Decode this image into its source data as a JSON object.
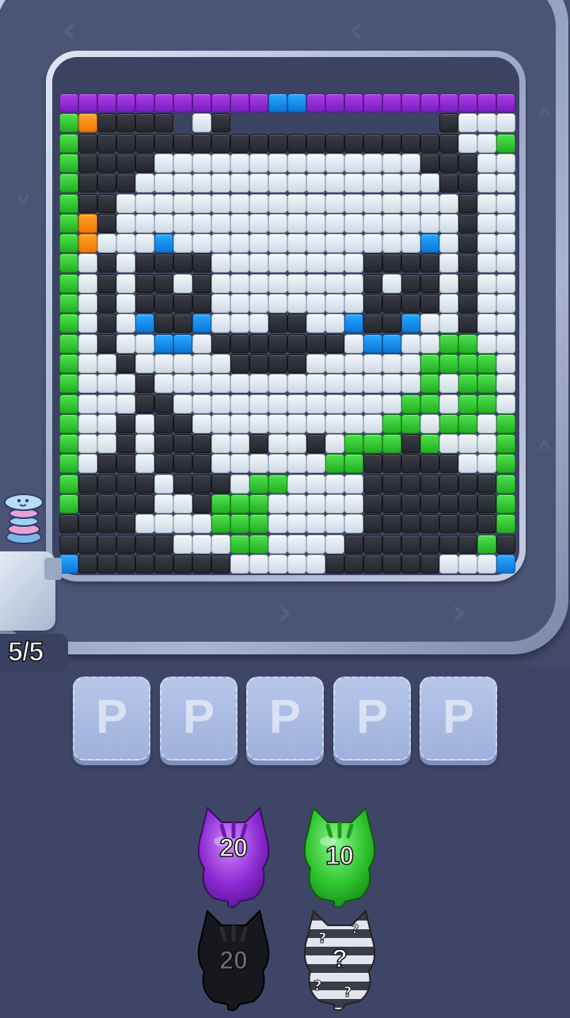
{
  "board": {
    "palette": {
      "k": "#2b2d35",
      "w": "#e3eaf1",
      "g": "#2fc52f",
      "p": "#8e2bd4",
      "b": "#1592ee",
      "o": "#ff8c0f"
    },
    "rows": [
      "pppppppppppbbppppppppppp",
      "gokkkk.wk...........kwwwg",
      "gkkkkkkkkkkkkkkkkkkkkwwg",
      "gkkkkwwwwwwwwwwwwwwkkkwwg",
      "gkkkwwwwwwwwwwwwwwwwkkwwg",
      "gkkwwwwwwwwwwwwwwwwwwkwwg",
      "gokwwwwwwwwwwwwwwwwwwkwwg",
      "gowwwbwwwwwwwwwwwwwbwkwwg",
      "gwkwkkkkwwwwwwwwkkkkwkwwg",
      "gwkwkkwkwwwwwwwwkwkkwkwwg",
      "gwkwkkkkwwwwwwwwkkkkwkwwg",
      "gwkwbkkbwwwkkwwbkkbwwkwwg",
      "gwkwwbbwkkkkkkkwbbwwggww",
      "gwwkwwwwwkkkkwwwwwwggggwg",
      "gwwwkwwwwwwwwwwwwwwgwggwg",
      "gwwwkkwwwwwwwwwwwwggwggwg",
      "gwwkwkkwwwwwwwwwwggwggwg",
      "gwwkwkkkwwkwwkwgggkgwwwg",
      "gwkkwkkkwwwwwwggkkkkkwwg",
      "gkkkkwkkkwggwwwwkkkkkkkg",
      "gkkkkwwkgggwwwwwkkkkkkkg",
      "kkkkwwwwgggwwwwwkkkkkkkg",
      "kkkkkkwwwggwwwwkkkkkkkg",
      "bkkkkkkkkwwwwwkkkkkkwwwb"
    ]
  },
  "moves_counter": "5/5",
  "slots": [
    {
      "label": "P"
    },
    {
      "label": "P"
    },
    {
      "label": "P"
    },
    {
      "label": "P"
    },
    {
      "label": "P"
    }
  ],
  "cats": [
    {
      "color": "purple",
      "count": "20",
      "hex": "#9b3fe8"
    },
    {
      "color": "green",
      "count": "10",
      "hex": "#2fc52f"
    },
    {
      "color": "black",
      "count": "20",
      "hex": "#1c1c22"
    },
    {
      "color": "mystery-striped",
      "count": "?",
      "hex": "#d6d9e6"
    }
  ]
}
